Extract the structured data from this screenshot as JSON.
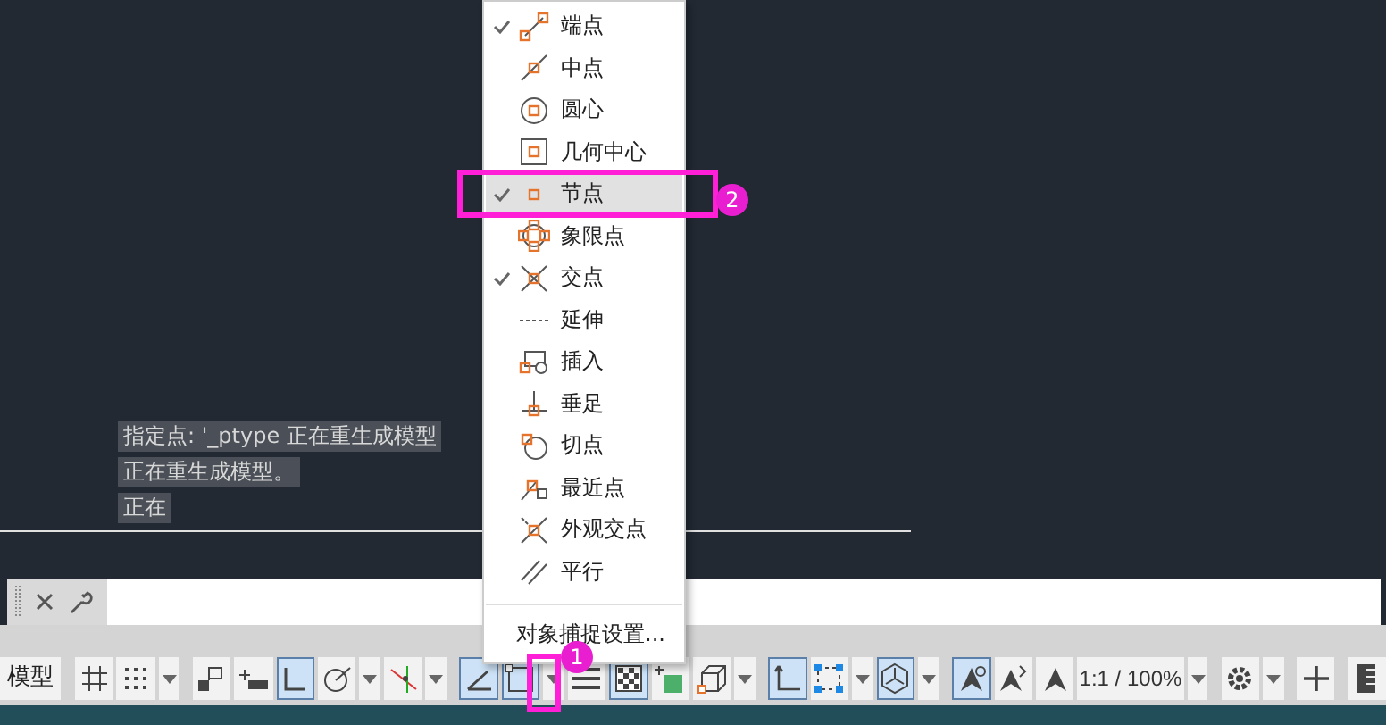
{
  "menu": {
    "items": [
      {
        "label": "端点",
        "checked": true,
        "selected": false,
        "kind": "endpoint"
      },
      {
        "label": "中点",
        "checked": false,
        "selected": false,
        "kind": "midpoint"
      },
      {
        "label": "圆心",
        "checked": false,
        "selected": false,
        "kind": "center"
      },
      {
        "label": "几何中心",
        "checked": false,
        "selected": false,
        "kind": "geocenter"
      },
      {
        "label": "节点",
        "checked": true,
        "selected": true,
        "kind": "node"
      },
      {
        "label": "象限点",
        "checked": false,
        "selected": false,
        "kind": "quadrant"
      },
      {
        "label": "交点",
        "checked": true,
        "selected": false,
        "kind": "intersection"
      },
      {
        "label": "延伸",
        "checked": false,
        "selected": false,
        "kind": "extension"
      },
      {
        "label": "插入",
        "checked": false,
        "selected": false,
        "kind": "insert"
      },
      {
        "label": "垂足",
        "checked": false,
        "selected": false,
        "kind": "perpendicular"
      },
      {
        "label": "切点",
        "checked": false,
        "selected": false,
        "kind": "tangent"
      },
      {
        "label": "最近点",
        "checked": false,
        "selected": false,
        "kind": "nearest"
      },
      {
        "label": "外观交点",
        "checked": false,
        "selected": false,
        "kind": "apparent"
      },
      {
        "label": "平行",
        "checked": false,
        "selected": false,
        "kind": "parallel"
      }
    ],
    "settings": "对象捕捉设置..."
  },
  "command_history": [
    "指定点: '_ptype 正在重生成模型",
    "正在重生成模型。",
    "正在"
  ],
  "status_bar": {
    "model_tab": "模型",
    "scale": "1:1 / 100%",
    "items": [
      {
        "kind": "grid",
        "on": false
      },
      {
        "kind": "dots",
        "on": false
      },
      {
        "kind": "caret"
      },
      {
        "kind": "sep"
      },
      {
        "kind": "infer",
        "on": false
      },
      {
        "kind": "dynin",
        "on": false
      },
      {
        "kind": "ortho",
        "on": true
      },
      {
        "kind": "polar",
        "on": false
      },
      {
        "kind": "caret"
      },
      {
        "kind": "iso",
        "on": false
      },
      {
        "kind": "caret"
      },
      {
        "kind": "sep"
      },
      {
        "kind": "track",
        "on": true
      },
      {
        "kind": "osnap",
        "on": true
      },
      {
        "kind": "caret"
      },
      {
        "kind": "lineweight",
        "on": false
      },
      {
        "kind": "checker",
        "on": true
      },
      {
        "kind": "cycle",
        "on": false
      },
      {
        "kind": "cube",
        "on": false
      },
      {
        "kind": "caret"
      },
      {
        "kind": "sep"
      },
      {
        "kind": "ucs",
        "on": true
      },
      {
        "kind": "filter",
        "on": false
      },
      {
        "kind": "caret"
      },
      {
        "kind": "gizmo",
        "on": true
      },
      {
        "kind": "caret"
      },
      {
        "kind": "sep"
      },
      {
        "kind": "annovis",
        "on": true
      },
      {
        "kind": "autoscale",
        "on": false
      },
      {
        "kind": "annoscale",
        "on": false
      },
      {
        "kind": "scale"
      },
      {
        "kind": "caret"
      },
      {
        "kind": "sep"
      },
      {
        "kind": "gear"
      },
      {
        "kind": "caret"
      },
      {
        "kind": "sep"
      },
      {
        "kind": "plus"
      },
      {
        "kind": "sep"
      },
      {
        "kind": "ruler"
      }
    ]
  },
  "annotations": [
    {
      "label": "1"
    },
    {
      "label": "2"
    }
  ]
}
